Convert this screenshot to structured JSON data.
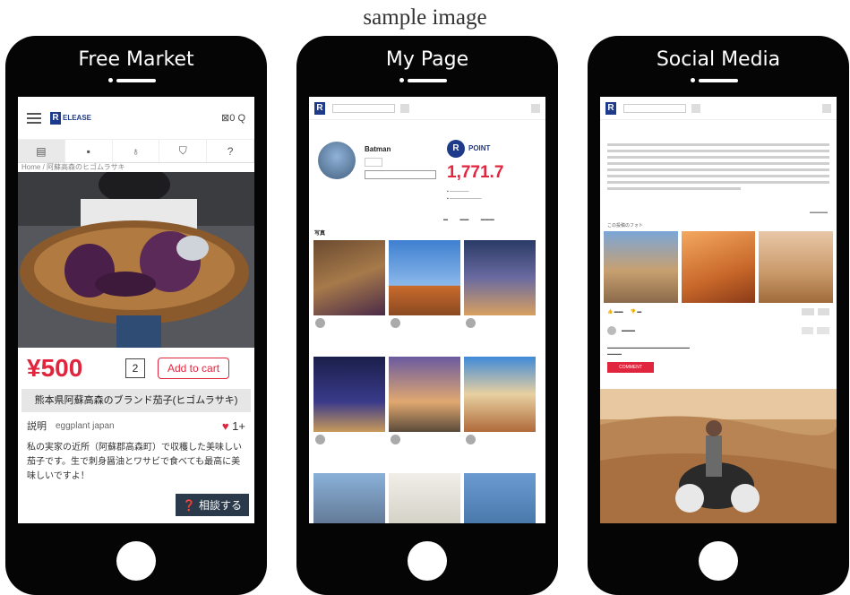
{
  "caption": "sample image",
  "phones": [
    {
      "title": "Free Market",
      "logo_text": "ELEASE",
      "header_right": "⊠0 Q",
      "breadcrumb": "Home / 阿蘇高森のヒゴムラサキ",
      "price": "¥500",
      "quantity": "2",
      "add_to_cart": "Add to cart",
      "product_title": "熊本県阿蘇高森のブランド茄子(ヒゴムラサキ)",
      "description_label": "説明",
      "seller": "eggplant japan",
      "likes": "1+",
      "description": "私の実家の近所（阿蘇郡高森町）で収穫した美味しい茄子です。生で刺身醤油とワサビで食べても最高に美味しいですよ！",
      "consult_button": "相談する"
    },
    {
      "title": "My Page",
      "profile_name": "Batman",
      "point_label": "POINT",
      "point_value": "1,771.7",
      "section_label": "写真"
    },
    {
      "title": "Social Media",
      "photos_label": "この投稿のフォト",
      "comment_button": "COMMENT"
    }
  ],
  "colors": {
    "accent_red": "#e0263e",
    "brand_blue": "#1e3a8a"
  }
}
